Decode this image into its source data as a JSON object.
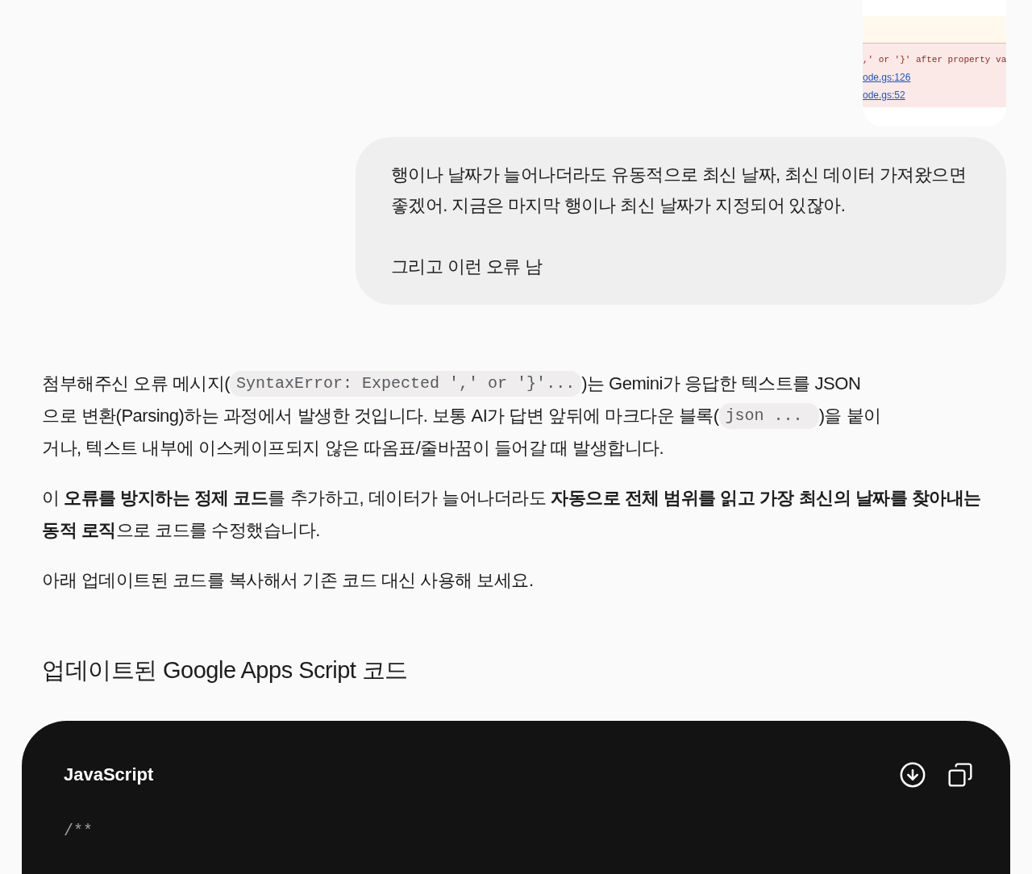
{
  "attachment": {
    "error_text": ",' or '}' after property va",
    "links": [
      "ode.gs:126",
      "ode.gs:52"
    ]
  },
  "user_message": {
    "paragraphs": [
      "행이나 날짜가 늘어나더라도 유동적으로 최신 날짜, 최신 데이터 가져왔으면 좋겠어. 지금은 마지막 행이나 최신 날짜가 지정되어 있잖아.",
      "그리고 이런 오류 남"
    ]
  },
  "response": {
    "paragraphs": [
      {
        "lines": [
          [
            {
              "kind": "text",
              "text": "첨부해주신 오류 메시지("
            },
            {
              "kind": "code",
              "text": "SyntaxError: Expected ',' or '}'..."
            },
            {
              "kind": "text",
              "text": ")는 Gemini가 응답한 텍스트를 JSON"
            }
          ],
          [
            {
              "kind": "text",
              "text": "으로 변환(Parsing)하는 과정에서 발생한 것입니다. 보통 AI가 답변 앞뒤에 마크다운 블록("
            },
            {
              "kind": "code",
              "text": "json ... "
            },
            {
              "kind": "text",
              "text": ")을 붙이"
            }
          ],
          [
            {
              "kind": "text",
              "text": "거나, 텍스트 내부에 이스케이프되지 않은 따옴표/줄바꿈이 들어갈 때 발생합니다."
            }
          ]
        ]
      },
      {
        "lines": [
          [
            {
              "kind": "text",
              "text": "이 **오류를 방지하는 정제 코드**를 추가하고, 데이터가 늘어나더라도 **자동으로 전체 범위를 읽고 가장 최신의 날짜를 찾아내는 동적 로직**으로 코드를 수정했습니다."
            }
          ]
        ]
      },
      {
        "lines": [
          [
            {
              "kind": "text",
              "text": "아래 업데이트된 코드를 복사해서 기존 코드 대신 사용해 보세요."
            }
          ]
        ]
      }
    ],
    "heading": "업데이트된 Google Apps Script 코드",
    "code_block": {
      "language": "JavaScript",
      "lines": [
        "/**"
      ]
    }
  }
}
